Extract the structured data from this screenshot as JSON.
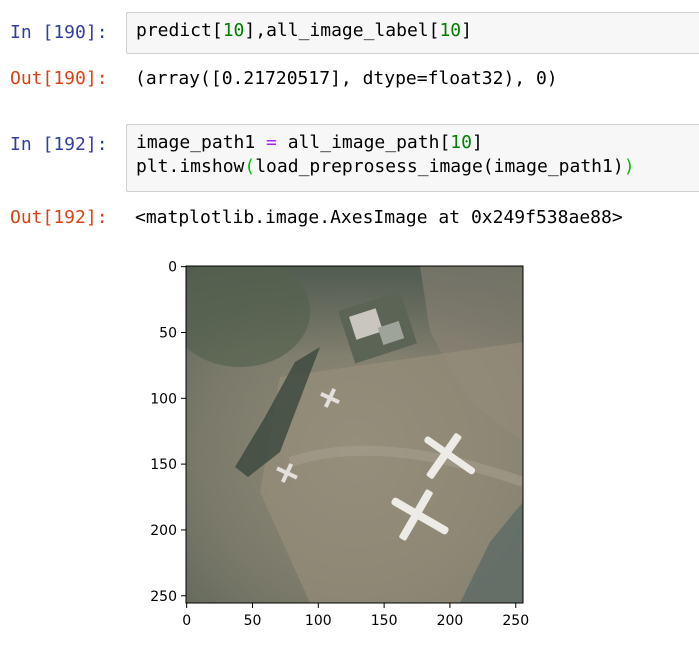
{
  "cells": [
    {
      "in_prompt": "In [190]:",
      "code": {
        "part1": "predict[",
        "num1": "10",
        "part2": "],all_image_label[",
        "num2": "10",
        "part3": "]"
      },
      "out_prompt": "Out[190]:",
      "output": "(array([0.21720517], dtype=float32), 0)"
    },
    {
      "in_prompt": "In [192]:",
      "code_line1": {
        "lhs": "image_path1 ",
        "op": "=",
        "rhs": " all_image_path[",
        "num": "10",
        "end": "]"
      },
      "code_line2": {
        "fn": "plt.imshow",
        "open": "(",
        "call": "load_preprosess_image(image_path1)",
        "close": ")"
      },
      "out_prompt": "Out[192]:",
      "output": "<matplotlib.image.AxesImage at 0x249f538ae88>"
    }
  ],
  "figure": {
    "x_ticks": [
      "0",
      "50",
      "100",
      "150",
      "200",
      "250"
    ],
    "y_ticks": [
      "0",
      "50",
      "100",
      "150",
      "200",
      "250"
    ],
    "image_size": 256,
    "image_description_icon": "aerial-airport-image"
  }
}
